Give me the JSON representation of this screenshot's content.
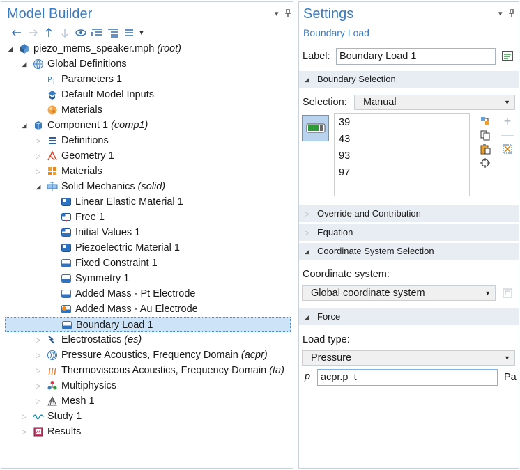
{
  "model_builder": {
    "title": "Model Builder",
    "tree": [
      {
        "id": "root",
        "depth": 0,
        "twisty": "open",
        "icon": "model-file-icon",
        "label": "piezo_mems_speaker.mph",
        "tag": "(root)"
      },
      {
        "id": "global-definitions",
        "depth": 1,
        "twisty": "open",
        "icon": "globe-icon",
        "label": "Global Definitions",
        "tag": ""
      },
      {
        "id": "parameters-1",
        "depth": 2,
        "twisty": "",
        "icon": "parameters-icon",
        "label": "Parameters 1",
        "tag": ""
      },
      {
        "id": "default-model-inputs",
        "depth": 2,
        "twisty": "",
        "icon": "model-inputs-icon",
        "label": "Default Model Inputs",
        "tag": ""
      },
      {
        "id": "global-materials",
        "depth": 2,
        "twisty": "",
        "icon": "material-sphere-icon",
        "label": "Materials",
        "tag": ""
      },
      {
        "id": "component-1",
        "depth": 1,
        "twisty": "open",
        "icon": "component-cube-icon",
        "label": "Component 1",
        "tag": "(comp1)"
      },
      {
        "id": "definitions",
        "depth": 2,
        "twisty": "closed",
        "icon": "definitions-list-icon",
        "label": "Definitions",
        "tag": ""
      },
      {
        "id": "geometry-1",
        "depth": 2,
        "twisty": "closed",
        "icon": "geometry-icon",
        "label": "Geometry 1",
        "tag": ""
      },
      {
        "id": "comp-materials",
        "depth": 2,
        "twisty": "closed",
        "icon": "materials-grid-icon",
        "label": "Materials",
        "tag": ""
      },
      {
        "id": "solid-mechanics",
        "depth": 2,
        "twisty": "open",
        "icon": "solid-mechanics-icon",
        "label": "Solid Mechanics",
        "tag": "(solid)"
      },
      {
        "id": "linear-elastic-material-1",
        "depth": 3,
        "twisty": "",
        "icon": "domain-feature-icon",
        "label": "Linear Elastic Material 1",
        "tag": ""
      },
      {
        "id": "free-1",
        "depth": 3,
        "twisty": "",
        "icon": "free-feature-icon",
        "label": "Free 1",
        "tag": ""
      },
      {
        "id": "initial-values-1",
        "depth": 3,
        "twisty": "",
        "icon": "initial-values-icon",
        "label": "Initial Values 1",
        "tag": ""
      },
      {
        "id": "piezoelectric-material-1",
        "depth": 3,
        "twisty": "",
        "icon": "domain-feature-icon",
        "label": "Piezoelectric Material 1",
        "tag": ""
      },
      {
        "id": "fixed-constraint-1",
        "depth": 3,
        "twisty": "",
        "icon": "boundary-feature-icon",
        "label": "Fixed Constraint 1",
        "tag": ""
      },
      {
        "id": "symmetry-1",
        "depth": 3,
        "twisty": "",
        "icon": "boundary-feature-icon",
        "label": "Symmetry 1",
        "tag": ""
      },
      {
        "id": "added-mass-pt",
        "depth": 3,
        "twisty": "",
        "icon": "boundary-feature-icon",
        "label": "Added Mass - Pt Electrode",
        "tag": ""
      },
      {
        "id": "added-mass-au",
        "depth": 3,
        "twisty": "",
        "icon": "added-mass-icon",
        "label": "Added Mass - Au Electrode",
        "tag": ""
      },
      {
        "id": "boundary-load-1",
        "depth": 3,
        "twisty": "",
        "icon": "boundary-feature-icon",
        "label": "Boundary Load 1",
        "tag": "",
        "selected": true
      },
      {
        "id": "electrostatics",
        "depth": 2,
        "twisty": "closed",
        "icon": "electrostatics-icon",
        "label": "Electrostatics",
        "tag": "(es)"
      },
      {
        "id": "pressure-acoustics",
        "depth": 2,
        "twisty": "closed",
        "icon": "pressure-acoustics-icon",
        "label": "Pressure Acoustics, Frequency Domain",
        "tag": "(acpr)"
      },
      {
        "id": "thermoviscous-acoustics",
        "depth": 2,
        "twisty": "closed",
        "icon": "thermoviscous-icon",
        "label": "Thermoviscous Acoustics, Frequency Domain",
        "tag": "(ta)"
      },
      {
        "id": "multiphysics",
        "depth": 2,
        "twisty": "closed",
        "icon": "multiphysics-icon",
        "label": "Multiphysics",
        "tag": ""
      },
      {
        "id": "mesh-1",
        "depth": 2,
        "twisty": "closed",
        "icon": "mesh-icon",
        "label": "Mesh 1",
        "tag": ""
      },
      {
        "id": "study-1",
        "depth": 1,
        "twisty": "closed",
        "icon": "study-icon",
        "label": "Study 1",
        "tag": ""
      },
      {
        "id": "results",
        "depth": 1,
        "twisty": "closed",
        "icon": "results-icon",
        "label": "Results",
        "tag": ""
      }
    ]
  },
  "settings": {
    "title": "Settings",
    "subtitle": "Boundary Load",
    "label_caption": "Label:",
    "label_value": "Boundary Load 1",
    "sections": {
      "boundary_selection": "Boundary Selection",
      "override": "Override and Contribution",
      "equation": "Equation",
      "coordinate_system": "Coordinate System Selection",
      "force": "Force"
    },
    "selection_caption": "Selection:",
    "selection_value": "Manual",
    "selection_items": [
      "39",
      "43",
      "93",
      "97"
    ],
    "coord_caption": "Coordinate system:",
    "coord_value": "Global coordinate system",
    "load_type_caption": "Load type:",
    "load_type_value": "Pressure",
    "pressure_symbol": "p",
    "pressure_value": "acpr.p_t",
    "pressure_unit": "Pa"
  }
}
